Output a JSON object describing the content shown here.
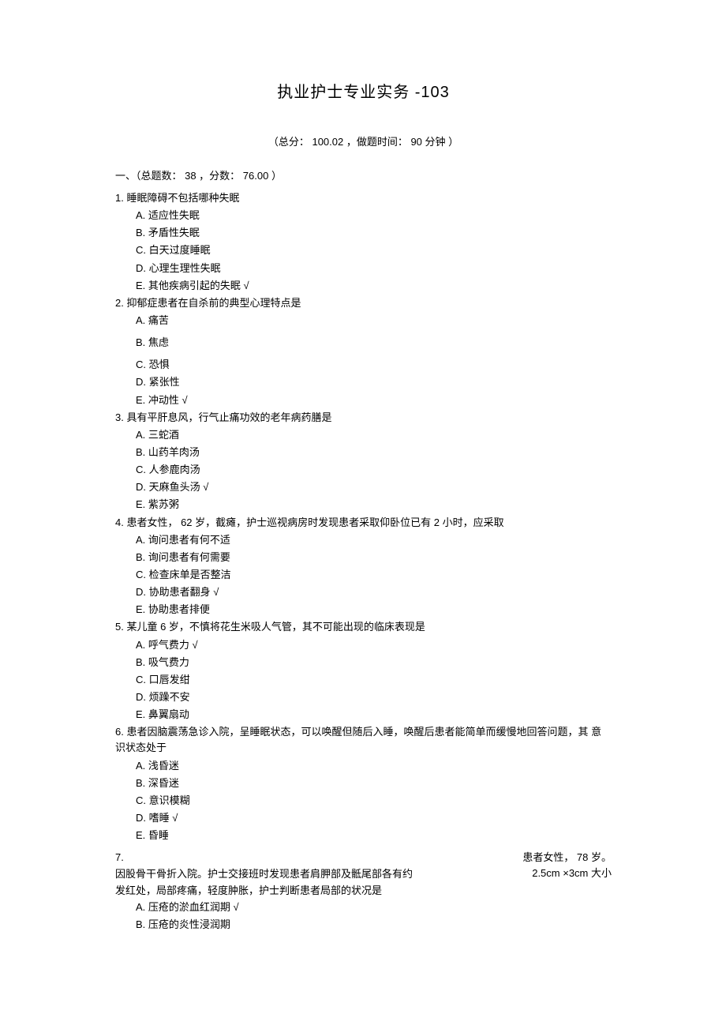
{
  "title": "执业护士专业实务 -103",
  "meta": "（总分： 100.02 ，做题时间： 90 分钟 ）",
  "section": "一、（总题数： 38 ，分数： 76.00 ）",
  "check": "√",
  "q1": {
    "stem": "1.  睡眠障碍不包括哪种失眠",
    "A": "A.  适应性失眠",
    "B": "B.  矛盾性失眠",
    "C": "C.  白天过度睡眠",
    "D": "D.  心理生理性失眠",
    "E": "E.  其他疾病引起的失眠 "
  },
  "q2": {
    "stem": "2.  抑郁症患者在自杀前的典型心理特点是",
    "A": "A.  痛苦",
    "B": "B.  焦虑",
    "C": "C.  恐惧",
    "D": "D.  紧张性",
    "E": "E.  冲动性 "
  },
  "q3": {
    "stem": "3.  具有平肝息风，行气止痛功效的老年病药膳是",
    "A": "A.  三蛇酒",
    "B": "B.  山药羊肉汤",
    "C": "C.  人参鹿肉汤",
    "D": "D.  天麻鱼头汤 ",
    "E": "E.  紫苏粥"
  },
  "q4": {
    "stem": "4.     患者女性， 62 岁，截瘫，护士巡视病房时发现患者采取仰卧位已有 2 小时，应采取",
    "A": "A.  询问患者有何不适",
    "B": "B.  询问患者有何需要",
    "C": "C.  检查床单是否整洁",
    "D": "D.  协助患者翻身 ",
    "E": "E.  协助患者排便"
  },
  "q5": {
    "stem": "5.     某儿童 6 岁，不慎将花生米吸人气管，其不可能出现的临床表现是",
    "A": "A.  呼气费力 ",
    "B": "B.  吸气费力",
    "C": "C.  口唇发绀",
    "D": "D.  烦躁不安",
    "E": "E.  鼻翼扇动"
  },
  "q6": {
    "stem": "6.  患者因脑震荡急诊入院，呈睡眠状态，可以唤醒但随后入睡，唤醒后患者能简单而缓慢地回答问题，其 意识状态处于",
    "A": "A.  浅昏迷",
    "B": "B.  深昏迷",
    "C": "C.  意识模糊",
    "D": "D.  嗜睡  ",
    "E": "E.  昏睡"
  },
  "q7": {
    "num": "7.",
    "right1": "患者女性， 78 岁。",
    "line2": "因股骨干骨折入院。护士交接班时发现患者肩胛部及骶尾部各有约",
    "right2": "2.5cm ×3cm 大小",
    "line3": "发红处，局部疼痛，轻度肿胀，护士判断患者局部的状况是",
    "A": "A.  压疮的淤血红润期 ",
    "B": "B.  压疮的炎性浸润期"
  }
}
